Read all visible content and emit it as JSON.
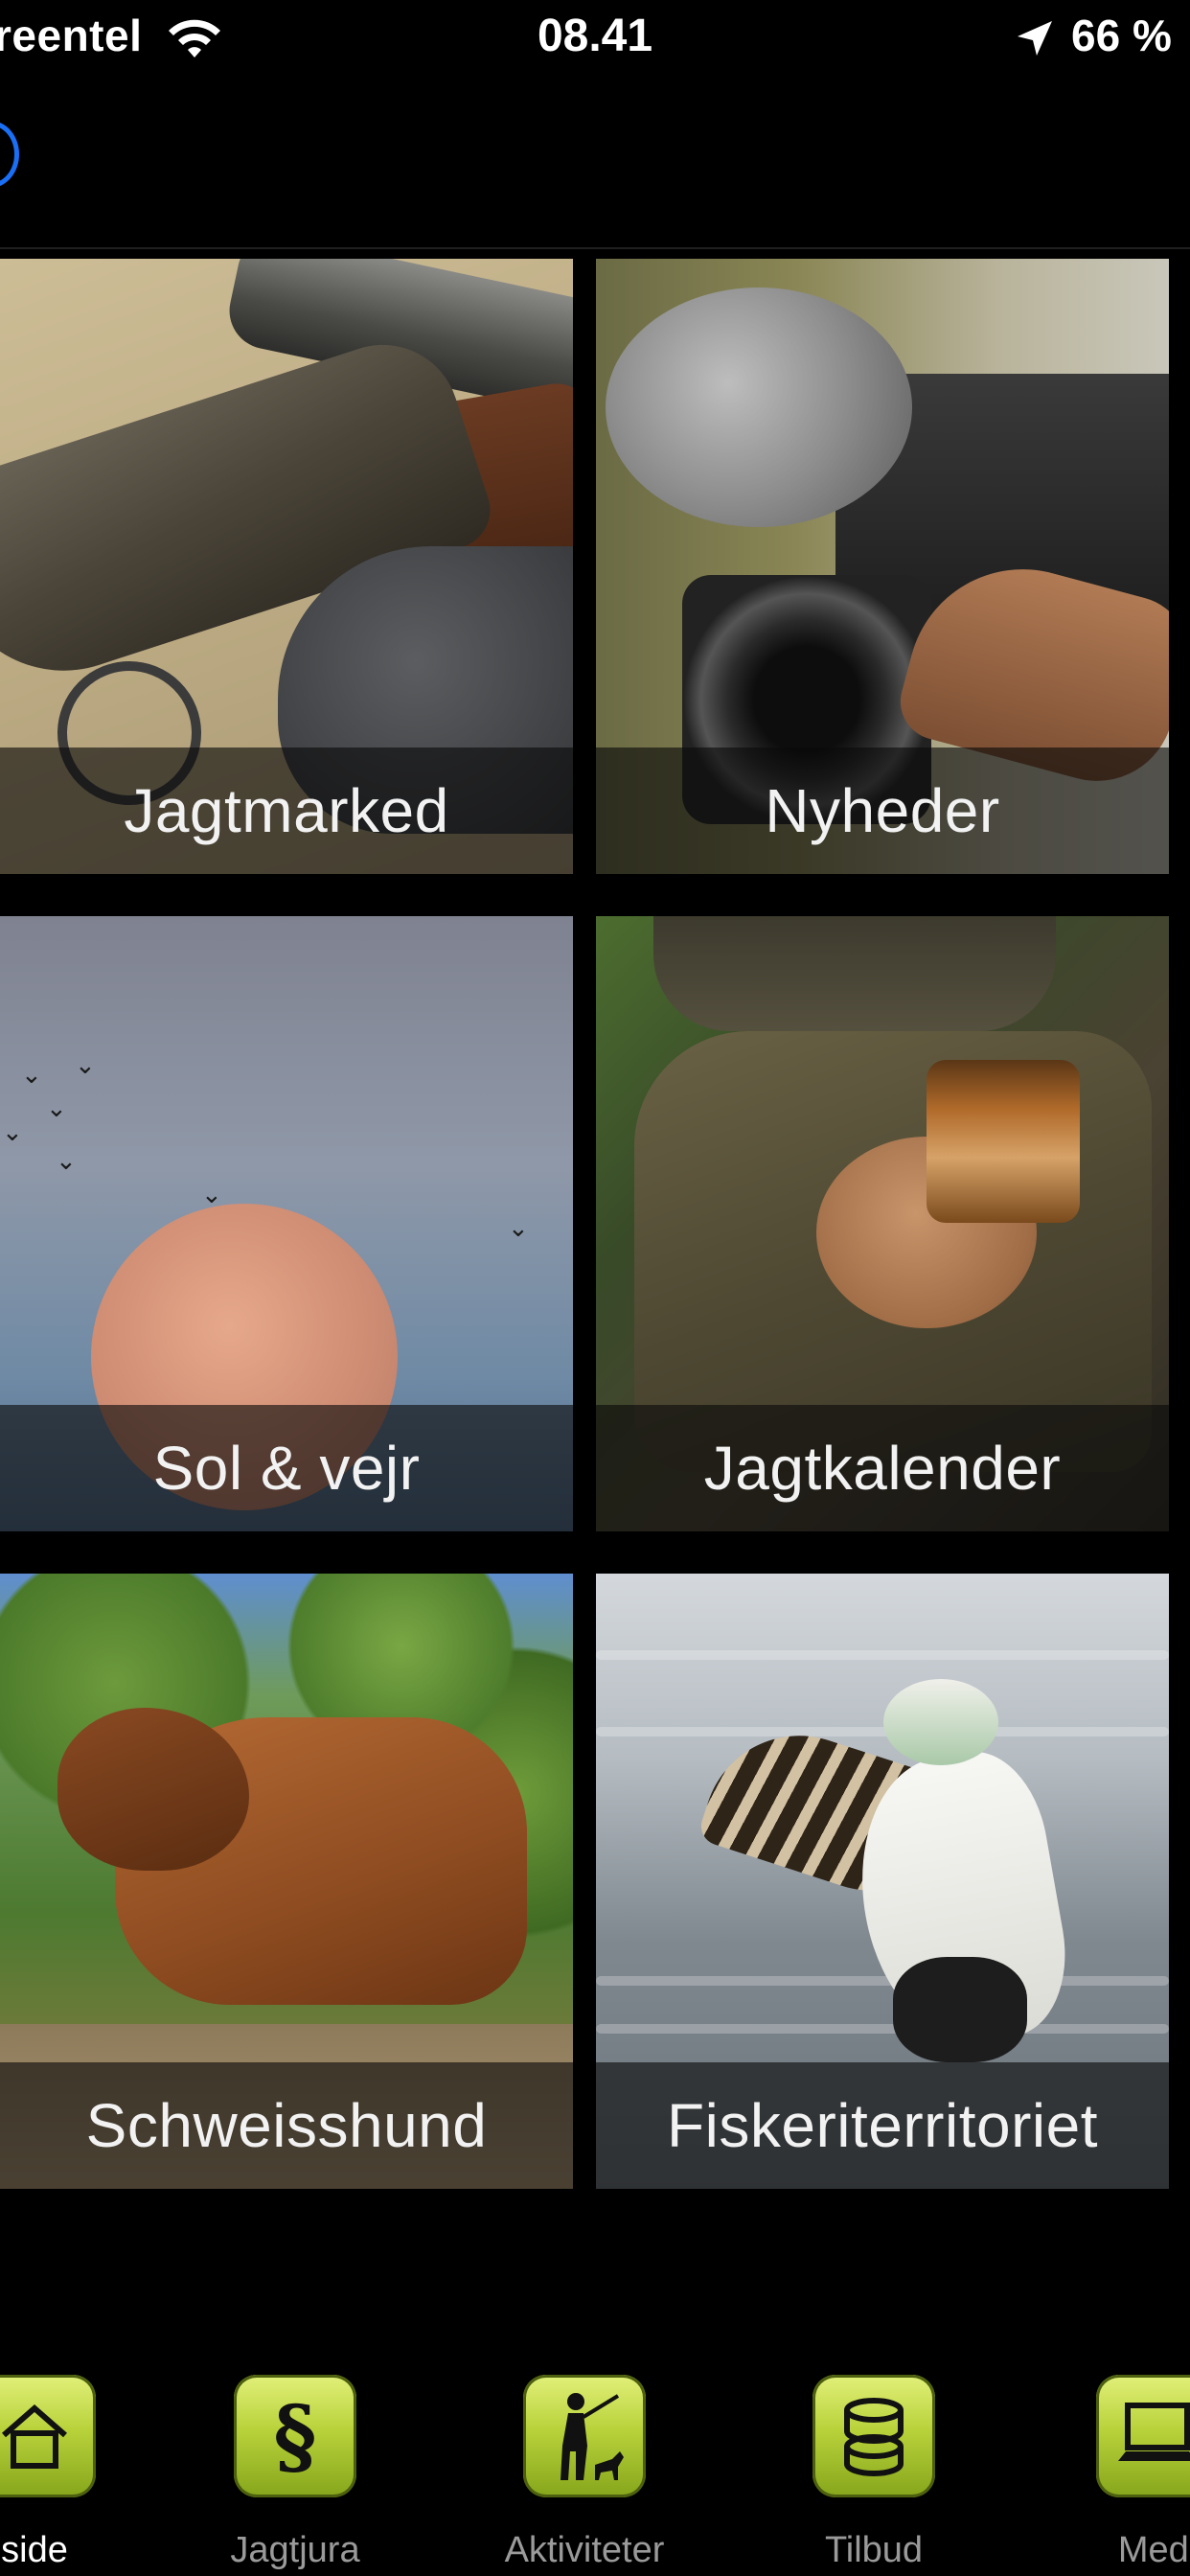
{
  "status_bar": {
    "carrier": "reentel",
    "time": "08.41",
    "battery": "66 %",
    "icons": [
      "wifi-icon",
      "location-arrow-icon"
    ]
  },
  "nav": {
    "back_icon": "back-circle-icon",
    "accent_color": "#1a6ff5"
  },
  "tiles": [
    {
      "label": "Jagtmarked",
      "image": "shotgun-photo"
    },
    {
      "label": "Nyheder",
      "image": "news-camera-photo"
    },
    {
      "label": "Sol & vejr",
      "image": "moon-birds-photo"
    },
    {
      "label": "Jagtkalender",
      "image": "jar-pouch-photo"
    },
    {
      "label": "Schweisshund",
      "image": "bloodhound-photo"
    },
    {
      "label": "Fiskeriterritoriet",
      "image": "eider-duck-photo"
    }
  ],
  "tab_bar": {
    "active_index": 0,
    "tab_icon_color": "#b8d23a",
    "items": [
      {
        "label": "side",
        "icon": "home-icon"
      },
      {
        "label": "Jagtjura",
        "icon": "paragraph-icon"
      },
      {
        "label": "Aktiviteter",
        "icon": "hunter-dog-icon"
      },
      {
        "label": "Tilbud",
        "icon": "coins-icon"
      },
      {
        "label": "Medi",
        "icon": "laptop-media-icon"
      }
    ]
  }
}
